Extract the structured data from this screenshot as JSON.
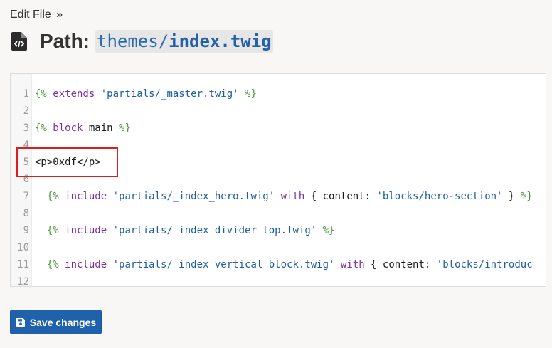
{
  "breadcrumb": {
    "label": "Edit File",
    "separator": "»"
  },
  "header": {
    "label": "Path:",
    "path_prefix": "themes/",
    "path_file": "index.twig",
    "icon": "file-code-icon"
  },
  "editor": {
    "lines": [
      {
        "num": "1",
        "tokens": [
          {
            "t": "tag",
            "v": "{%"
          },
          {
            "t": "kw",
            "v": " extends"
          },
          {
            "t": "txt",
            "v": " "
          },
          {
            "t": "str",
            "v": "'partials/_master.twig'"
          },
          {
            "t": "txt",
            "v": " "
          },
          {
            "t": "tag",
            "v": "%}"
          }
        ]
      },
      {
        "num": "2",
        "tokens": []
      },
      {
        "num": "3",
        "tokens": [
          {
            "t": "tag",
            "v": "{%"
          },
          {
            "t": "kw",
            "v": " block"
          },
          {
            "t": "txt",
            "v": " main "
          },
          {
            "t": "tag",
            "v": "%}"
          }
        ]
      },
      {
        "num": "4",
        "tokens": []
      },
      {
        "num": "5",
        "tokens": [
          {
            "t": "txt",
            "v": "<p>0xdf</p>"
          }
        ]
      },
      {
        "num": "6",
        "tokens": []
      },
      {
        "num": "7",
        "tokens": [
          {
            "t": "txt",
            "v": "  "
          },
          {
            "t": "tag",
            "v": "{%"
          },
          {
            "t": "kw",
            "v": " include"
          },
          {
            "t": "txt",
            "v": " "
          },
          {
            "t": "str",
            "v": "'partials/_index_hero.twig'"
          },
          {
            "t": "txt",
            "v": " "
          },
          {
            "t": "kw",
            "v": "with"
          },
          {
            "t": "txt",
            "v": " { content: "
          },
          {
            "t": "str",
            "v": "'blocks/hero-section'"
          },
          {
            "t": "txt",
            "v": " } "
          },
          {
            "t": "tag",
            "v": "%}"
          }
        ]
      },
      {
        "num": "8",
        "tokens": []
      },
      {
        "num": "9",
        "tokens": [
          {
            "t": "txt",
            "v": "  "
          },
          {
            "t": "tag",
            "v": "{%"
          },
          {
            "t": "kw",
            "v": " include"
          },
          {
            "t": "txt",
            "v": " "
          },
          {
            "t": "str",
            "v": "'partials/_index_divider_top.twig'"
          },
          {
            "t": "txt",
            "v": " "
          },
          {
            "t": "tag",
            "v": "%}"
          }
        ]
      },
      {
        "num": "10",
        "tokens": []
      },
      {
        "num": "11",
        "tokens": [
          {
            "t": "txt",
            "v": "  "
          },
          {
            "t": "tag",
            "v": "{%"
          },
          {
            "t": "kw",
            "v": " include"
          },
          {
            "t": "txt",
            "v": " "
          },
          {
            "t": "str",
            "v": "'partials/_index_vertical_block.twig'"
          },
          {
            "t": "txt",
            "v": " "
          },
          {
            "t": "kw",
            "v": "with"
          },
          {
            "t": "txt",
            "v": " { content: "
          },
          {
            "t": "str",
            "v": "'blocks/introduc"
          }
        ]
      },
      {
        "num": "12",
        "tokens": []
      }
    ],
    "highlighted_line": "5"
  },
  "actions": {
    "save_label": "Save changes",
    "save_icon": "floppy-disk-icon"
  },
  "colors": {
    "accent": "#1f62ab",
    "twig_tag": "#4c9a3f",
    "keyword": "#7b2fa0",
    "string": "#1c5ea3",
    "highlight_border": "#d9201f"
  }
}
